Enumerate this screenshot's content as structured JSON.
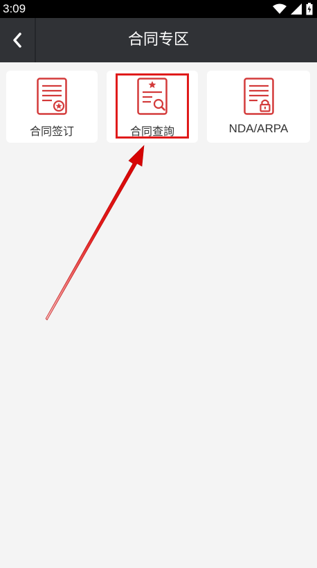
{
  "status_bar": {
    "time": "3:09"
  },
  "header": {
    "title": "合同专区"
  },
  "cards": [
    {
      "label": "合同签订"
    },
    {
      "label": "合同查詢"
    },
    {
      "label": "NDA/ARPA"
    }
  ],
  "colors": {
    "accent": "#d33a3a",
    "header_bg": "#303236",
    "page_bg": "#f4f4f4"
  }
}
